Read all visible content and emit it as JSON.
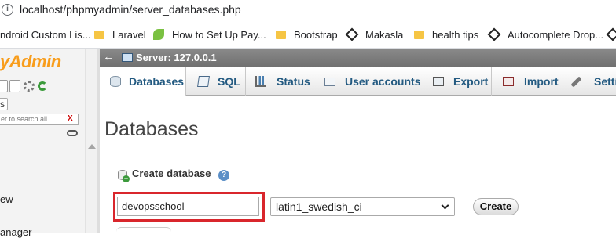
{
  "browser": {
    "url": "localhost/phpmyadmin/server_databases.php",
    "bookmarks": [
      {
        "label": "ndroid Custom Lis...",
        "icon": "page-icon"
      },
      {
        "label": "Laravel",
        "icon": "folder-icon"
      },
      {
        "label": "How to Set Up Pay...",
        "icon": "leaf-icon"
      },
      {
        "label": "Bootstrap",
        "icon": "folder-icon"
      },
      {
        "label": "Makasla",
        "icon": "codepen-icon"
      },
      {
        "label": "health tips",
        "icon": "folder-icon"
      },
      {
        "label": "Autocomplete Drop...",
        "icon": "codepen-icon"
      }
    ]
  },
  "nav": {
    "logo": "yAdmin",
    "collapse_label": "s",
    "filter_placeholder": "er to search all",
    "filter_clear": "X",
    "item_partial_1": "ew",
    "item_partial_2": "anager"
  },
  "server": {
    "back_arrow": "←",
    "label": "Server: 127.0.0.1"
  },
  "tabs": [
    {
      "label": "Databases",
      "icon": "database-icon",
      "active": true
    },
    {
      "label": "SQL",
      "icon": "sql-icon",
      "active": false
    },
    {
      "label": "Status",
      "icon": "status-icon",
      "active": false
    },
    {
      "label": "User accounts",
      "icon": "users-icon",
      "active": false
    },
    {
      "label": "Export",
      "icon": "export-icon",
      "active": false
    },
    {
      "label": "Import",
      "icon": "import-icon",
      "active": false
    },
    {
      "label": "Setti",
      "icon": "settings-icon",
      "active": false
    }
  ],
  "main": {
    "title": "Databases",
    "create_db_label": "Create database",
    "help_icon": "?",
    "db_name_value": "devopsschool",
    "collation_value": "latin1_swedish_ci",
    "create_button": "Create"
  },
  "colors": {
    "highlight_border": "#d9262c",
    "tab_text": "#235a81",
    "server_bar": "#777777",
    "logo_orange": "#f89d1c"
  }
}
